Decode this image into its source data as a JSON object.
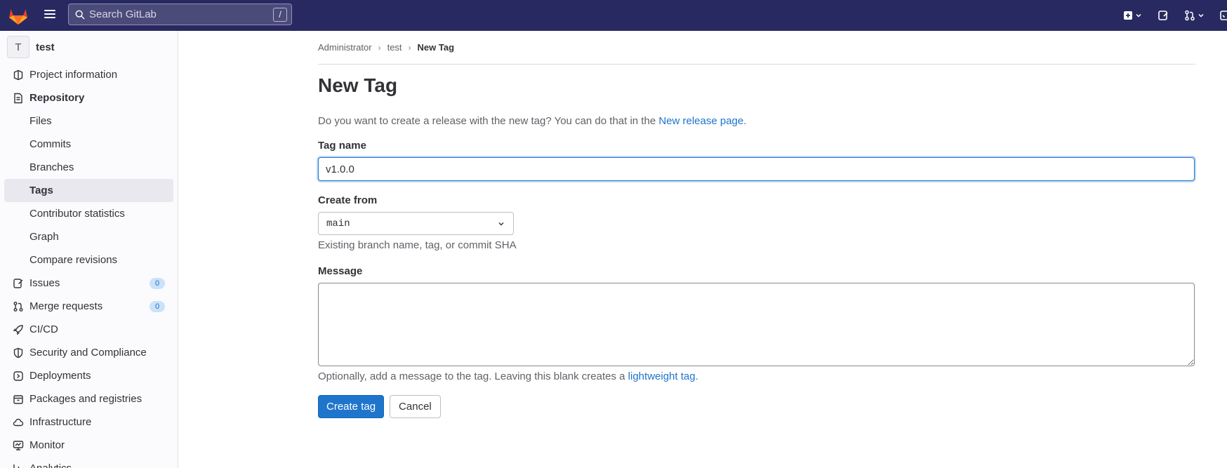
{
  "app": {
    "brand_color": "#292961",
    "accent": "#1f75cb"
  },
  "navbar": {
    "search_placeholder": "Search GitLab",
    "search_shortcut": "/"
  },
  "sidebar": {
    "project_initial": "T",
    "project_name": "test",
    "items": [
      {
        "label": "Project information",
        "icon": "project-info-icon"
      },
      {
        "label": "Repository",
        "icon": "repository-icon"
      },
      {
        "label": "Files"
      },
      {
        "label": "Commits"
      },
      {
        "label": "Branches"
      },
      {
        "label": "Tags"
      },
      {
        "label": "Contributor statistics"
      },
      {
        "label": "Graph"
      },
      {
        "label": "Compare revisions"
      },
      {
        "label": "Issues",
        "icon": "issues-icon",
        "count": "0"
      },
      {
        "label": "Merge requests",
        "icon": "merge-request-icon",
        "count": "0"
      },
      {
        "label": "CI/CD",
        "icon": "rocket-icon"
      },
      {
        "label": "Security and Compliance",
        "icon": "shield-icon"
      },
      {
        "label": "Deployments",
        "icon": "deployments-icon"
      },
      {
        "label": "Packages and registries",
        "icon": "package-icon"
      },
      {
        "label": "Infrastructure",
        "icon": "cloud-icon"
      },
      {
        "label": "Monitor",
        "icon": "monitor-icon"
      },
      {
        "label": "Analytics",
        "icon": "chart-icon"
      }
    ]
  },
  "breadcrumb": {
    "items": [
      "Administrator",
      "test",
      "New Tag"
    ]
  },
  "page": {
    "title": "New Tag",
    "intro_text": "Do you want to create a release with the new tag? You can do that in the ",
    "intro_link": "New release page",
    "intro_end": ".",
    "tag_name_label": "Tag name",
    "tag_name_value": "v1.0.0",
    "create_from_label": "Create from",
    "create_from_value": "main",
    "create_from_help": "Existing branch name, tag, or commit SHA",
    "message_label": "Message",
    "message_value": "",
    "message_help": "Optionally, add a message to the tag. Leaving this blank creates a ",
    "message_help_link": "lightweight tag",
    "message_help_end": ".",
    "create_button": "Create tag",
    "cancel_button": "Cancel"
  }
}
